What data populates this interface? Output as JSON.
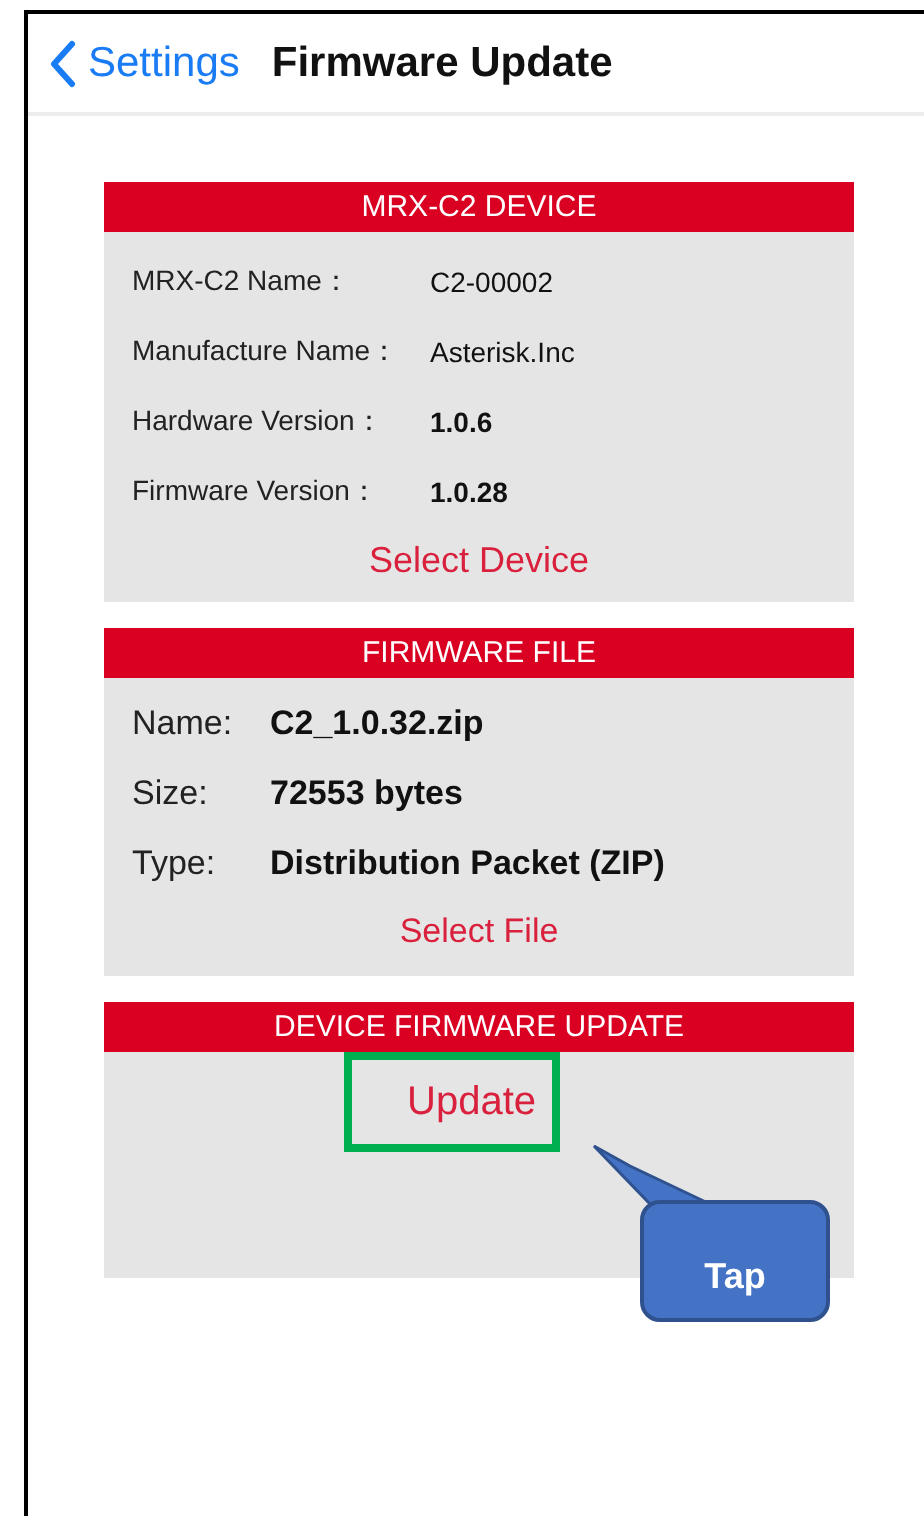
{
  "nav": {
    "back": "Settings",
    "title": "Firmware Update"
  },
  "sections": [
    {
      "kind": "device",
      "title": "MRX-C2 DEVICE",
      "rows": [
        {
          "label": "MRX-C2 Name：",
          "value": "C2-00002",
          "bold": false
        },
        {
          "label": "Manufacture Name：",
          "value": "Asterisk.Inc",
          "bold": false
        },
        {
          "label": "Hardware Version：",
          "value": "1.0.6",
          "bold": true
        },
        {
          "label": "Firmware Version：",
          "value": "1.0.28",
          "bold": true
        }
      ],
      "action": "Select Device"
    },
    {
      "kind": "file",
      "title": "FIRMWARE FILE",
      "rows": [
        {
          "label": "Name:",
          "value": "C2_1.0.32.zip",
          "bold": true
        },
        {
          "label": "Size:",
          "value": "72553 bytes",
          "bold": true
        },
        {
          "label": "Type:",
          "value": "Distribution Packet (ZIP)",
          "bold": true
        }
      ],
      "action": "Select File"
    },
    {
      "kind": "update",
      "title": "DEVICE FIRMWARE UPDATE",
      "action": "Update",
      "highlighted": true,
      "callout": "Tap"
    }
  ]
}
